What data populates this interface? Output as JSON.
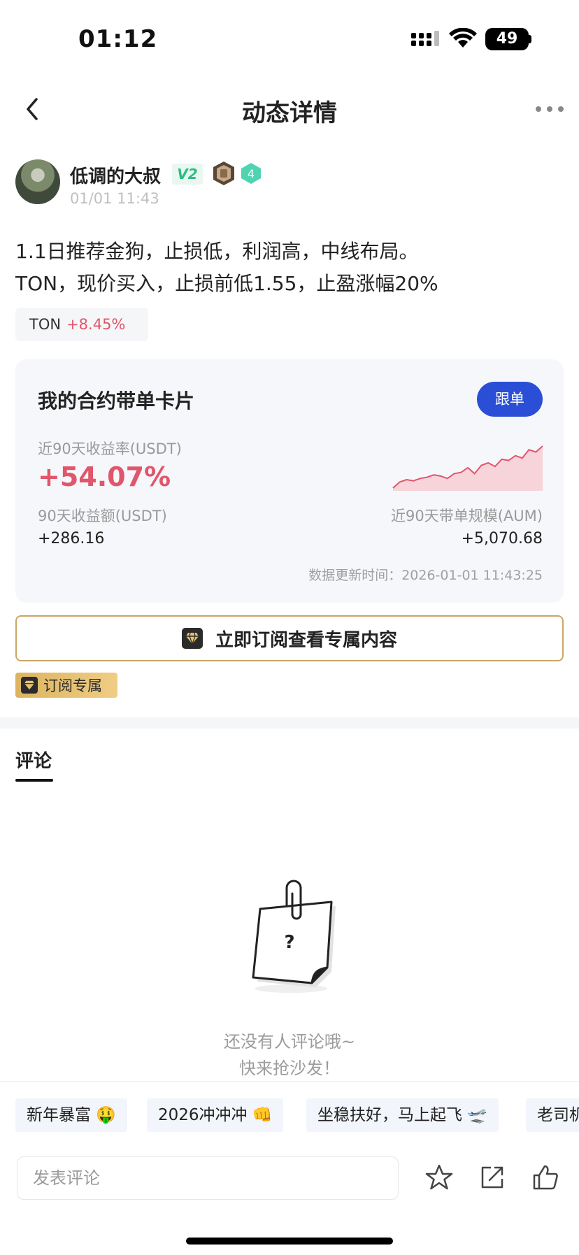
{
  "status_bar": {
    "time": "01:12",
    "battery": "49"
  },
  "nav": {
    "title": "动态详情"
  },
  "author": {
    "name": "低调的大叔",
    "vip_badge": "V2",
    "level": "4",
    "post_time": "01/01 11:43"
  },
  "post": {
    "lines": [
      "1.1日推荐金狗，止损低，利润高，中线布局。",
      "TON，现价买入，止损前低1.55，止盈涨幅20%"
    ],
    "coin_tag": {
      "symbol": "TON",
      "change": "+8.45%"
    }
  },
  "card": {
    "title": "我的合约带单卡片",
    "follow_button": "跟单",
    "rate_label": "近90天收益率(USDT)",
    "rate_value": "+54.07%",
    "earnings_label": "90天收益额(USDT)",
    "earnings_value": "+286.16",
    "aum_label": "近90天带单规模(AUM)",
    "aum_value": "+5,070.68",
    "update_time": "数据更新时间：2026-01-01 11:43:25",
    "sparkline": [
      3,
      8,
      10,
      9,
      11,
      12,
      14,
      13,
      11,
      15,
      16,
      20,
      15,
      22,
      24,
      21,
      27,
      26,
      30,
      28,
      35,
      33,
      38
    ]
  },
  "subscribe": {
    "button": "立即订阅查看专属内容",
    "tag": "订阅专属"
  },
  "comments": {
    "tab": "评论",
    "empty_line1": "还没有人评论哦~",
    "empty_line2": "快来抢沙发！"
  },
  "quick_replies": [
    "新年暴富 🤑",
    "2026冲冲冲 👊",
    "坐稳扶好，马上起飞 🛫",
    "老司机"
  ],
  "bottom": {
    "placeholder": "发表评论"
  },
  "colors": {
    "accent_blue": "#2a4fd6",
    "profit_red": "#e0566b",
    "gold": "#c9a766"
  }
}
